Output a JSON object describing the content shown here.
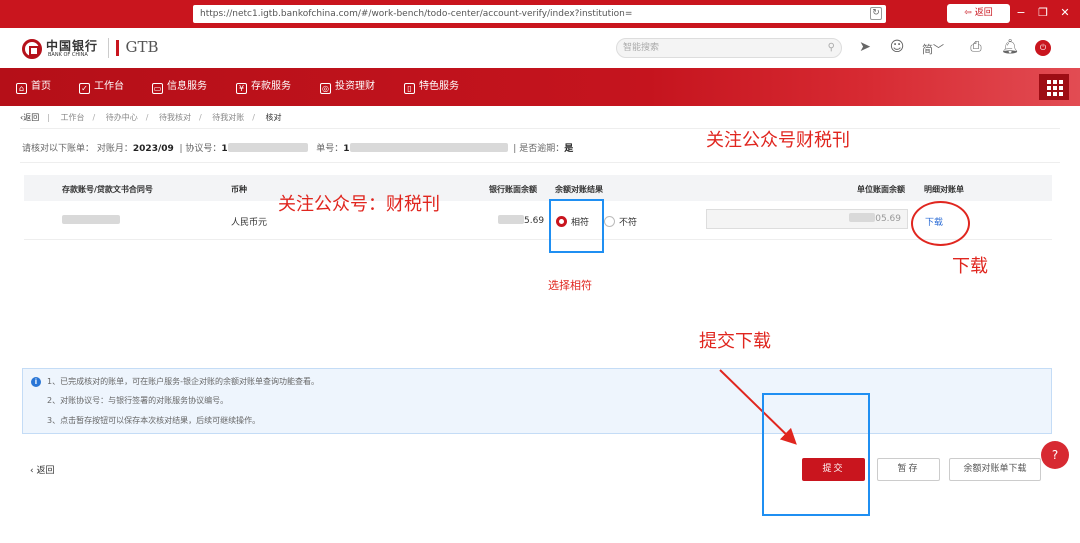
{
  "browser": {
    "url": "https://netc1.igtb.bankofchina.com/#/work-bench/todo-center/account-verify/index?institution=",
    "back_label": "返回",
    "refresh_glyph": "↻"
  },
  "header": {
    "logo_cn": "中国银行",
    "logo_en": "BANK OF CHINA",
    "logo_gtb": "GTB",
    "search_placeholder": "智能搜索",
    "lang_label": "简"
  },
  "nav": {
    "items": [
      {
        "label": "首页",
        "icon": "home-icon",
        "glyph": "⌂"
      },
      {
        "label": "工作台",
        "icon": "workbench-icon",
        "glyph": "✓"
      },
      {
        "label": "信息服务",
        "icon": "info-service-icon",
        "glyph": "▭"
      },
      {
        "label": "存款服务",
        "icon": "deposit-icon",
        "glyph": "¥"
      },
      {
        "label": "投资理财",
        "icon": "invest-icon",
        "glyph": "◎"
      },
      {
        "label": "特色服务",
        "icon": "feature-icon",
        "glyph": "▯"
      }
    ]
  },
  "breadcrumb": {
    "back": "返回",
    "items": [
      "工作台",
      "待办中心",
      "待我核对",
      "待我对账",
      "核对"
    ]
  },
  "info": {
    "prompt": "请核对以下账单：",
    "period_label": "对账月：",
    "period_value": "2023/09",
    "agreement_label": "协议号：",
    "agreement_value": "1",
    "bill_label": "单号：",
    "bill_value": "1",
    "overdue_label": "是否逾期：",
    "overdue_value": "是"
  },
  "table": {
    "headers": {
      "account": "存款账号/贷款文书合同号",
      "currency": "币种",
      "bank_balance": "银行账面余额",
      "result": "余额对账结果",
      "unit_balance": "单位账面余额",
      "detail": "明细对账单"
    },
    "row": {
      "currency": "人民币元",
      "bank_balance_suffix": "5.69",
      "option_match": "相符",
      "option_mismatch": "不符",
      "unit_balance_suffix": "05.69",
      "download": "下载"
    }
  },
  "notice": {
    "lines": [
      "1、已完成核对的账单，可在账户服务-银企对账的余额对账单查询功能查看。",
      "2、对账协议号：与银行签署的对账服务协议编号。",
      "3、点击暂存按钮可以保存本次核对结果，后续可继续操作。"
    ]
  },
  "actions": {
    "back": "返回",
    "submit": "提交",
    "save": "暂存",
    "statement_download": "余额对账单下载",
    "help": "?"
  },
  "annotations": {
    "follow_top": "关注公众号财税刊",
    "follow_mid": "关注公众号：财税刊",
    "download": "下载",
    "select_match": "选择相符",
    "submit_download": "提交下载"
  },
  "colors": {
    "brand_red": "#c9151e",
    "annotation_red": "#e0261f",
    "annotation_blue": "#1f8ff2",
    "link_blue": "#2a6bd5"
  }
}
